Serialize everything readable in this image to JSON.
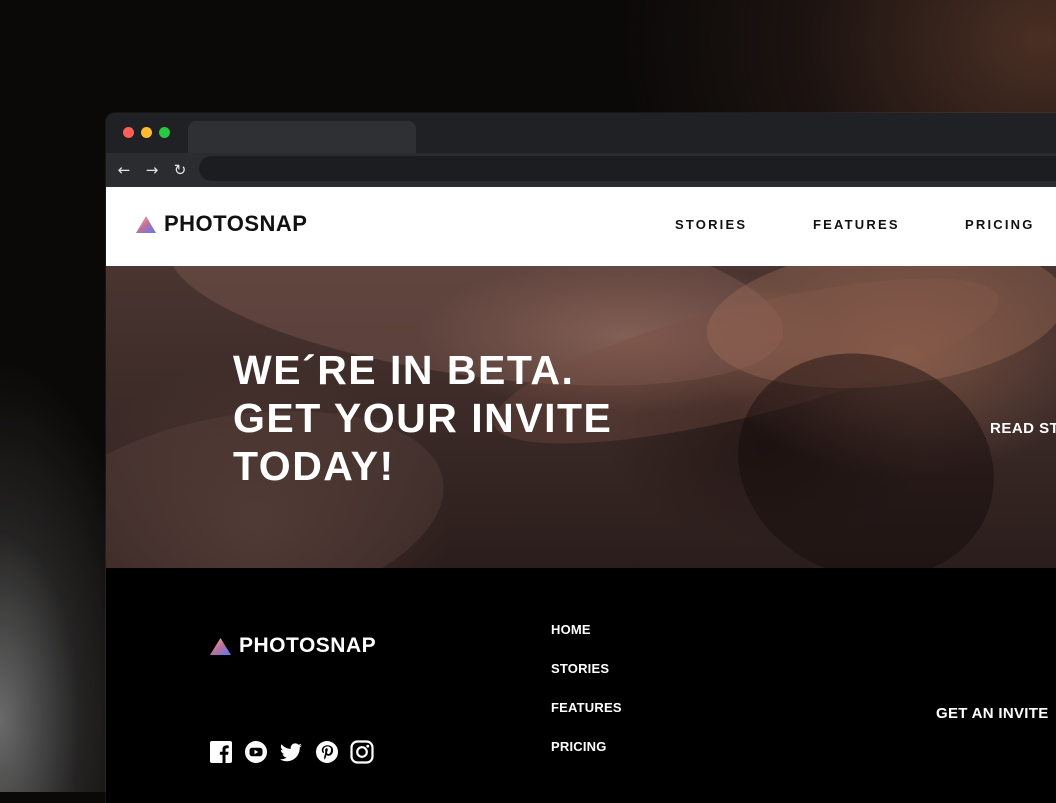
{
  "browser": {
    "window_controls": [
      {
        "name": "close",
        "color": "#ff5f57"
      },
      {
        "name": "minimize",
        "color": "#febc2e"
      },
      {
        "name": "maximize",
        "color": "#28c840"
      }
    ],
    "tab_title": "",
    "url": "",
    "back_icon": "←",
    "forward_icon": "→",
    "reload_icon": "↻"
  },
  "header": {
    "logo_text": "PHOTOSNAP",
    "nav": [
      "STORIES",
      "FEATURES",
      "PRICING"
    ]
  },
  "hero": {
    "title_lines": [
      "WE´RE IN BETA.",
      "GET YOUR INVITE",
      "TODAY!"
    ],
    "link_text": "READ ST"
  },
  "footer": {
    "logo_text": "PHOTOSNAP",
    "social_icons": [
      "facebook-icon",
      "youtube-icon",
      "twitter-icon",
      "pinterest-icon",
      "instagram-icon"
    ],
    "links": [
      "HOME",
      "STORIES",
      "FEATURES",
      "PRICING"
    ],
    "invite_text": "GET AN INVITE"
  },
  "colors": {
    "logo_gradient_start": "#ffc593",
    "logo_gradient_mid": "#bc7198",
    "logo_gradient_end": "#5a77ff",
    "footer_bg": "#000000",
    "header_bg": "#ffffff"
  }
}
